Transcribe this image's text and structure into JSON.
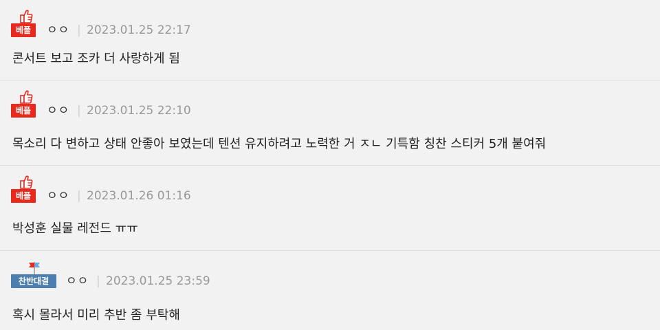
{
  "colors": {
    "best_badge": "#e8291d",
    "choice_badge": "#4c7fb0",
    "background": "#f2f2f2",
    "date_text": "#999999"
  },
  "comments": [
    {
      "badge_icon": "thumbs-up-icon",
      "badge_label": "베플",
      "author": "ㅇㅇ",
      "separator": "|",
      "date": "2023.01.25 22:17",
      "text": "콘서트 보고 조카 더 사랑하게 됨"
    },
    {
      "badge_icon": "thumbs-up-icon",
      "badge_label": "베플",
      "author": "ㅇㅇ",
      "separator": "|",
      "date": "2023.01.25 22:10",
      "text": "목소리 다 변하고 상태 안좋아 보였는데 텐션 유지하려고 노력한 거 ㅈㄴ 기특함 칭찬 스티커 5개 붙여줘"
    },
    {
      "badge_icon": "thumbs-up-icon",
      "badge_label": "베플",
      "author": "ㅇㅇ",
      "separator": "|",
      "date": "2023.01.26 01:16",
      "text": "박성훈 실물 레전드 ㅠㅠ"
    },
    {
      "badge_icon": "flags-icon",
      "badge_label": "찬반대결",
      "author": "ㅇㅇ",
      "separator": "|",
      "date": "2023.01.25 23:59",
      "text": "혹시 몰라서 미리 추반 좀 부탁해"
    }
  ]
}
